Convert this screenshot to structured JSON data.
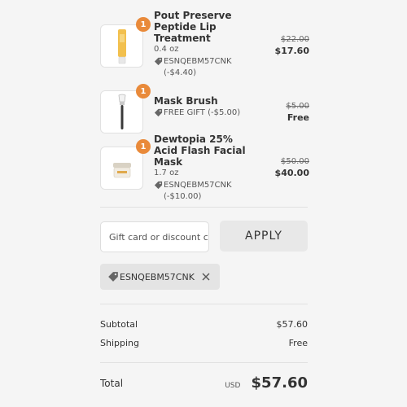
{
  "items": [
    {
      "quantity": "1",
      "name": "Pout Preserve Peptide Lip Treatment",
      "variant": "0.4 oz",
      "discount_text": "ESNQEBM57CNK (-$4.40)",
      "price_original": "$22.00",
      "price_final": "$17.60",
      "image_icon": "lip-tube-icon"
    },
    {
      "quantity": "1",
      "name": "Mask Brush",
      "variant": "",
      "discount_text": "FREE GIFT (-$5.00)",
      "price_original": "$5.00",
      "price_final": "Free",
      "image_icon": "mask-brush-icon"
    },
    {
      "quantity": "1",
      "name": "Dewtopia 25% Acid Flash Facial Mask",
      "variant": "1.7 oz",
      "discount_text": "ESNQEBM57CNK (-$10.00)",
      "price_original": "$50.00",
      "price_final": "$40.00",
      "image_icon": "mask-jar-icon"
    }
  ],
  "discount_form": {
    "placeholder": "Gift card or discount code",
    "apply_label": "APPLY"
  },
  "applied_code": {
    "code": "ESNQEBM57CNK",
    "icon": "tag-icon",
    "remove_icon": "close-icon"
  },
  "summary": {
    "subtotal_label": "Subtotal",
    "subtotal_value": "$57.60",
    "shipping_label": "Shipping",
    "shipping_value": "Free",
    "total_label": "Total",
    "currency": "USD",
    "total_value": "$57.60"
  },
  "colors": {
    "background": "#f5f5f5",
    "quantity_badge": "#e98a3a",
    "text": "#333333",
    "chip": "#e4e4e4"
  }
}
